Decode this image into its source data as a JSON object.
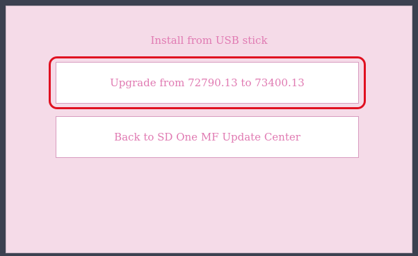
{
  "screen": {
    "title": "Install from USB stick"
  },
  "buttons": {
    "upgrade_label": "Upgrade from 72790.13 to 73400.13",
    "back_label": "Back to SD One MF Update Center"
  },
  "colors": {
    "background_outer": "#3c4150",
    "panel": "#f5dbe8",
    "text_accent": "#e07ab2",
    "highlight": "#e01020"
  }
}
